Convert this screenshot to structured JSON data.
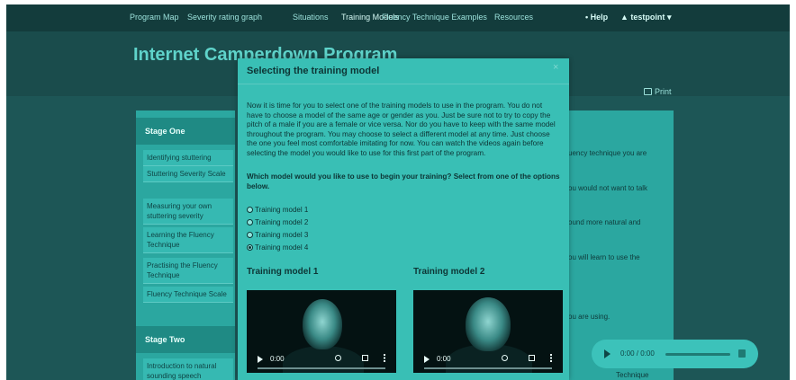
{
  "nav": {
    "items": [
      "Program Map",
      "Severity rating graph",
      "Situations",
      "Training Models",
      "Fluency Technique Examples",
      "Resources"
    ],
    "help": "Help",
    "user": "testpoint",
    "dropdown_glyph": "▾"
  },
  "header": {
    "title": "Internet Camperdown Program",
    "print": "Print"
  },
  "sidebar": {
    "stage_one": "Stage One",
    "stage_one_items": [
      "Identifying stuttering",
      "Stuttering Severity Scale",
      "Measuring your own stuttering severity",
      "Learning the Fluency Technique",
      "Practising the Fluency Technique",
      "Fluency Technique Scale"
    ],
    "stage_two": "Stage Two",
    "stage_two_items": [
      "Introduction to natural sounding speech"
    ]
  },
  "background_content": {
    "lines": [
      "fluency technique you are",
      "you would not want to talk",
      "sound more natural and",
      "you will learn to use the",
      "you are using.",
      "Technique"
    ],
    "audio_time": "0:00 / 0:00"
  },
  "modal": {
    "title": "Selecting the training model",
    "close": "×",
    "body": "Now it is time for you to select one of the training models to use in the program. You do not have to choose a model of the same age or gender as you. Just be sure not to try to copy the pitch of a male if you are a female or vice versa. Nor do you have to keep with the same model throughout the program. You may choose to select a different model at any time. Just choose the one you feel most comfortable imitating for now. You can watch the videos again before selecting the model you would like to use for this first part of the program.",
    "question": "Which model would you like to use to begin your training? Select from one of the options below.",
    "options": [
      "Training model 1",
      "Training model 2",
      "Training model 3",
      "Training model 4"
    ],
    "selected_option": "Training model 4",
    "models": [
      {
        "heading": "Training model 1",
        "time": "0:00"
      },
      {
        "heading": "Training model 2",
        "time": "0:00"
      }
    ]
  },
  "colors": {
    "page_bg": "#1d5656",
    "nav_bg": "#133c3c",
    "title": "#5fd3ca",
    "modal_bg": "#39bfb5",
    "sidebar": "#2ba7a0"
  }
}
